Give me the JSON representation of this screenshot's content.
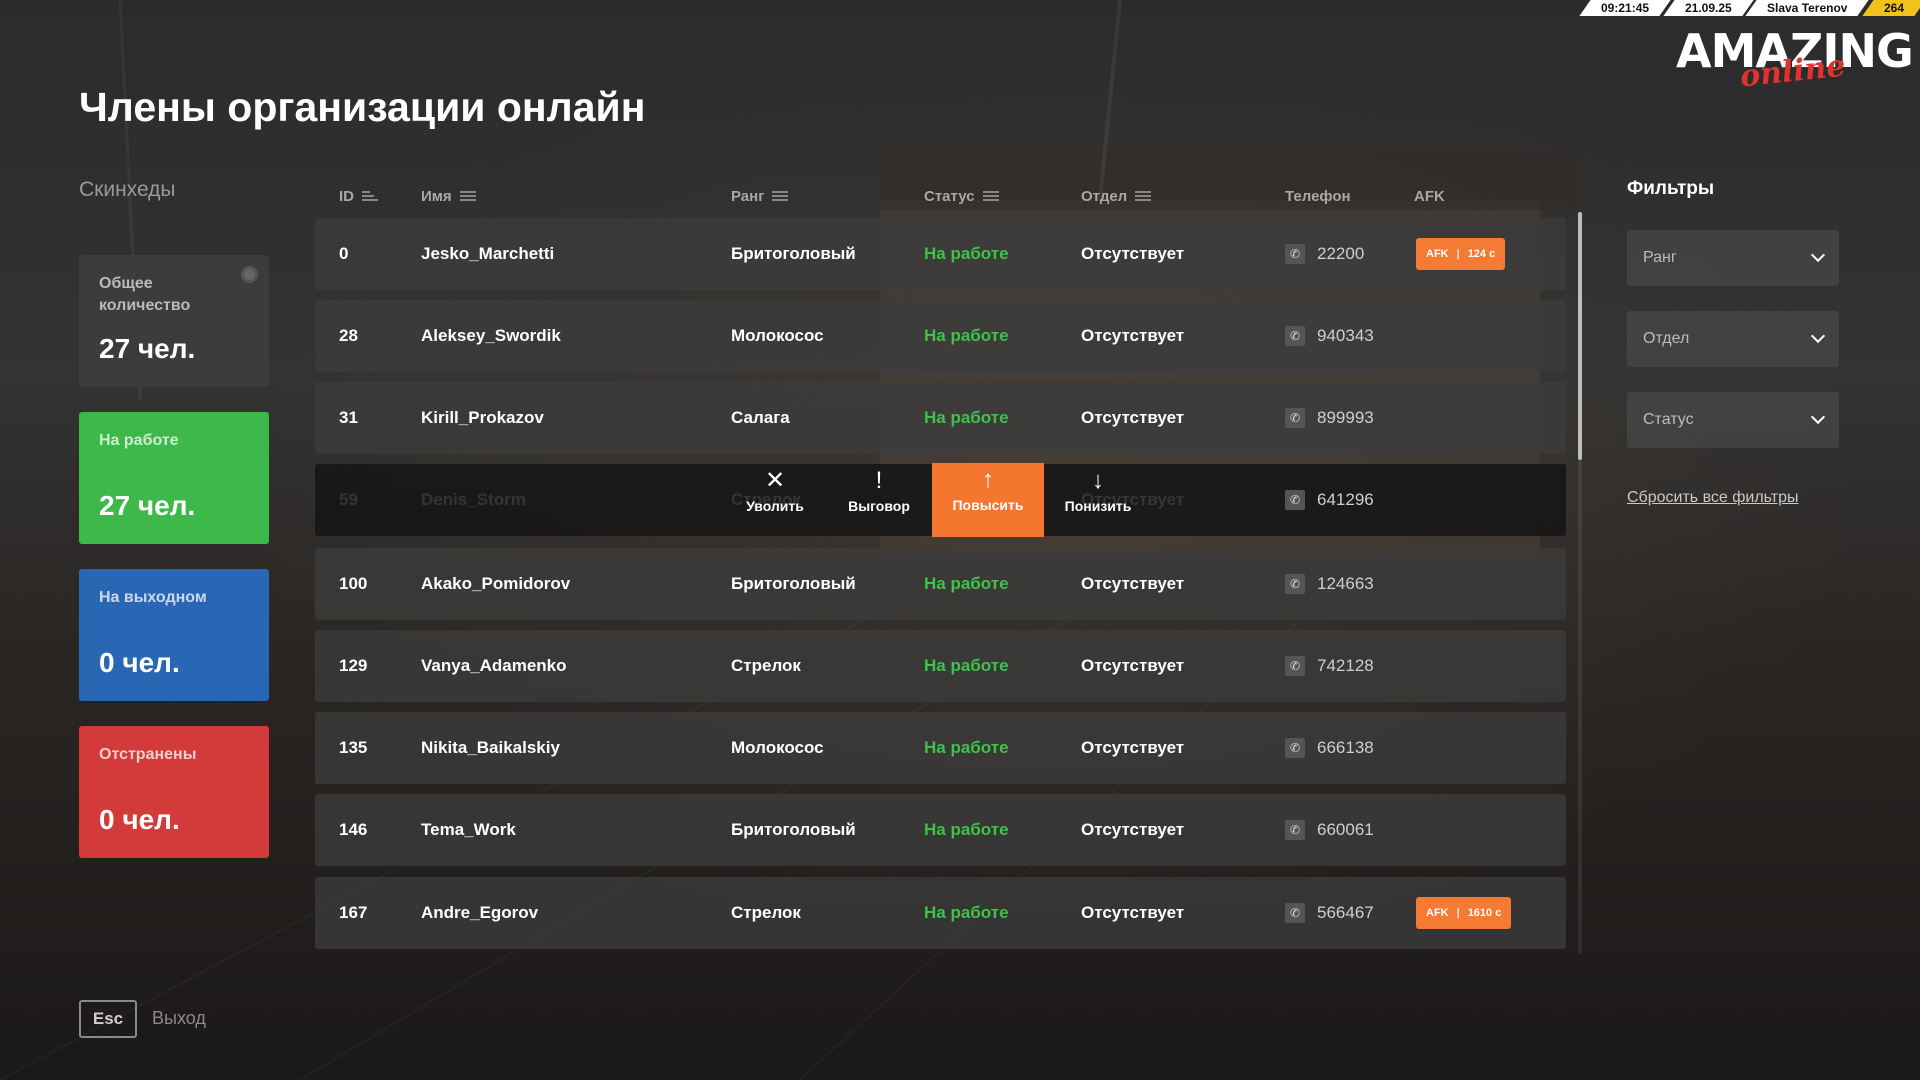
{
  "hud": {
    "time": "09:21:45",
    "date": "21.09.25",
    "player": "Slava Terenov",
    "id": "264"
  },
  "logo": {
    "main": "AMAZING",
    "sub": "online"
  },
  "page_title": "Члены организации онлайн",
  "section_label": "Скинхеды",
  "stats": {
    "total": {
      "label": "Общее количество",
      "value": "27 чел."
    },
    "working": {
      "label": "На работе",
      "value": "27 чел."
    },
    "off": {
      "label": "На выходном",
      "value": "0 чел."
    },
    "removed": {
      "label": "Отстранены",
      "value": "0 чел."
    }
  },
  "columns": {
    "id": "ID",
    "name": "Имя",
    "rank": "Ранг",
    "status": "Статус",
    "dept": "Отдел",
    "phone": "Телефон",
    "afk": "AFK"
  },
  "rows": [
    {
      "id": "0",
      "name": "Jesko_Marchetti",
      "rank": "Бритоголовый",
      "status": "На работе",
      "dept": "Отсутствует",
      "phone": "22200",
      "afk_label": "AFK",
      "afk_time": "124 с"
    },
    {
      "id": "28",
      "name": "Aleksey_Swordik",
      "rank": "Молокосос",
      "status": "На работе",
      "dept": "Отсутствует",
      "phone": "940343"
    },
    {
      "id": "31",
      "name": "Kirill_Prokazov",
      "rank": "Салага",
      "status": "На работе",
      "dept": "Отсутствует",
      "phone": "899993"
    },
    {
      "id": "59",
      "name": "Denis_Storm",
      "rank": "Стрелок",
      "status": "",
      "dept": "Отсутствует",
      "phone": "641296"
    },
    {
      "id": "100",
      "name": "Akako_Pomidorov",
      "rank": "Бритоголовый",
      "status": "На работе",
      "dept": "Отсутствует",
      "phone": "124663"
    },
    {
      "id": "129",
      "name": "Vanya_Adamenko",
      "rank": "Стрелок",
      "status": "На работе",
      "dept": "Отсутствует",
      "phone": "742128"
    },
    {
      "id": "135",
      "name": "Nikita_Baikalskiy",
      "rank": "Молокосос",
      "status": "На работе",
      "dept": "Отсутствует",
      "phone": "666138"
    },
    {
      "id": "146",
      "name": "Tema_Work",
      "rank": "Бритоголовый",
      "status": "На работе",
      "dept": "Отсутствует",
      "phone": "660061"
    },
    {
      "id": "167",
      "name": "Andre_Egorov",
      "rank": "Стрелок",
      "status": "На работе",
      "dept": "Отсутствует",
      "phone": "566467",
      "afk_label": "AFK",
      "afk_time": "1610 с"
    }
  ],
  "actions": {
    "fire": "Уволить",
    "warn": "Выговор",
    "promote": "Повысить",
    "demote": "Понизить"
  },
  "filters": {
    "title": "Фильтры",
    "rank": "Ранг",
    "dept": "Отдел",
    "status": "Статус",
    "reset": "Сбросить все фильтры"
  },
  "footer": {
    "key": "Esc",
    "label": "Выход"
  },
  "colors": {
    "accent": "#f5762e",
    "green": "#3db84a",
    "blue": "#2967b4",
    "red": "#d33b3b"
  }
}
